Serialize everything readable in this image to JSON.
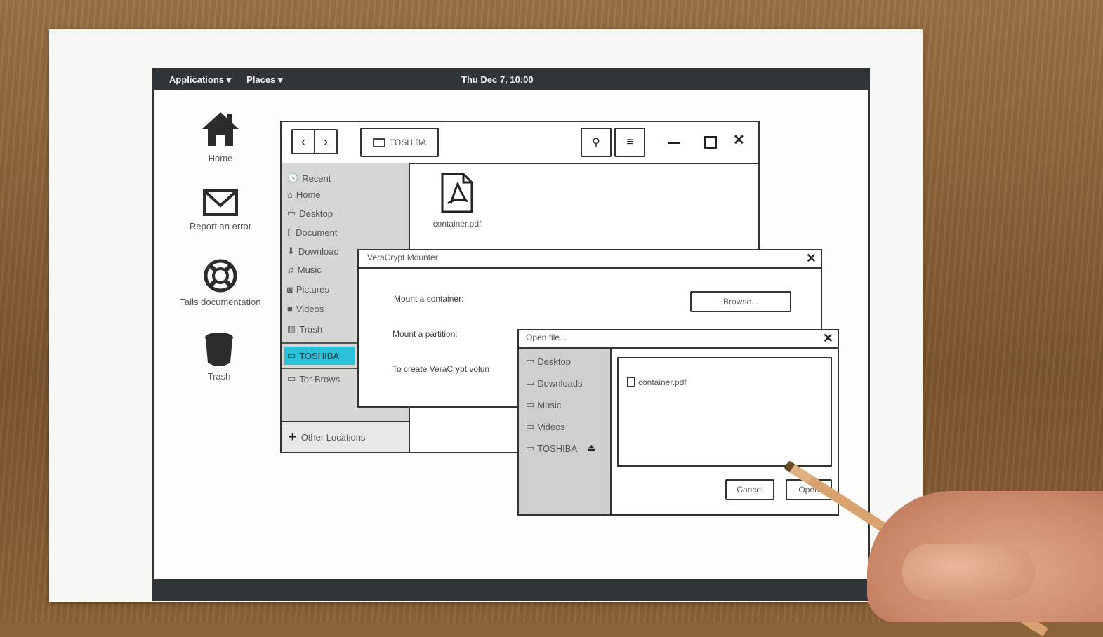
{
  "topbar": {
    "applications": "Applications ▾",
    "places": "Places ▾",
    "clock": "Thu Dec 7, 10:00"
  },
  "desktop": {
    "icons": [
      {
        "label": "Home"
      },
      {
        "label": "Report an error"
      },
      {
        "label": "Tails documentation"
      },
      {
        "label": "Trash"
      }
    ]
  },
  "files_window": {
    "location": "TOSHIBA",
    "sidebar": [
      "Recent",
      "Home",
      "Desktop",
      "Document",
      "Downloac",
      "Music",
      "Pictures",
      "Videos",
      "Trash",
      "TOSHIBA",
      "Tor Brows"
    ],
    "other_locations": "Other Locations",
    "file_name": "container.pdf",
    "highlight_color": "#29c0d8"
  },
  "veracrypt_dialog": {
    "title": "VeraCrypt Mounter",
    "mount_container": "Mount a container:",
    "mount_partition": "Mount a partition:",
    "create_text": "To create VeraCrypt volun",
    "browse": "Browse..."
  },
  "open_file_dialog": {
    "title": "Open file...",
    "places": [
      "Desktop",
      "Downloads",
      "Music",
      "Videos",
      "TOSHIBA"
    ],
    "file_name": "container.pdf",
    "cancel": "Cancel",
    "open": "Open"
  }
}
